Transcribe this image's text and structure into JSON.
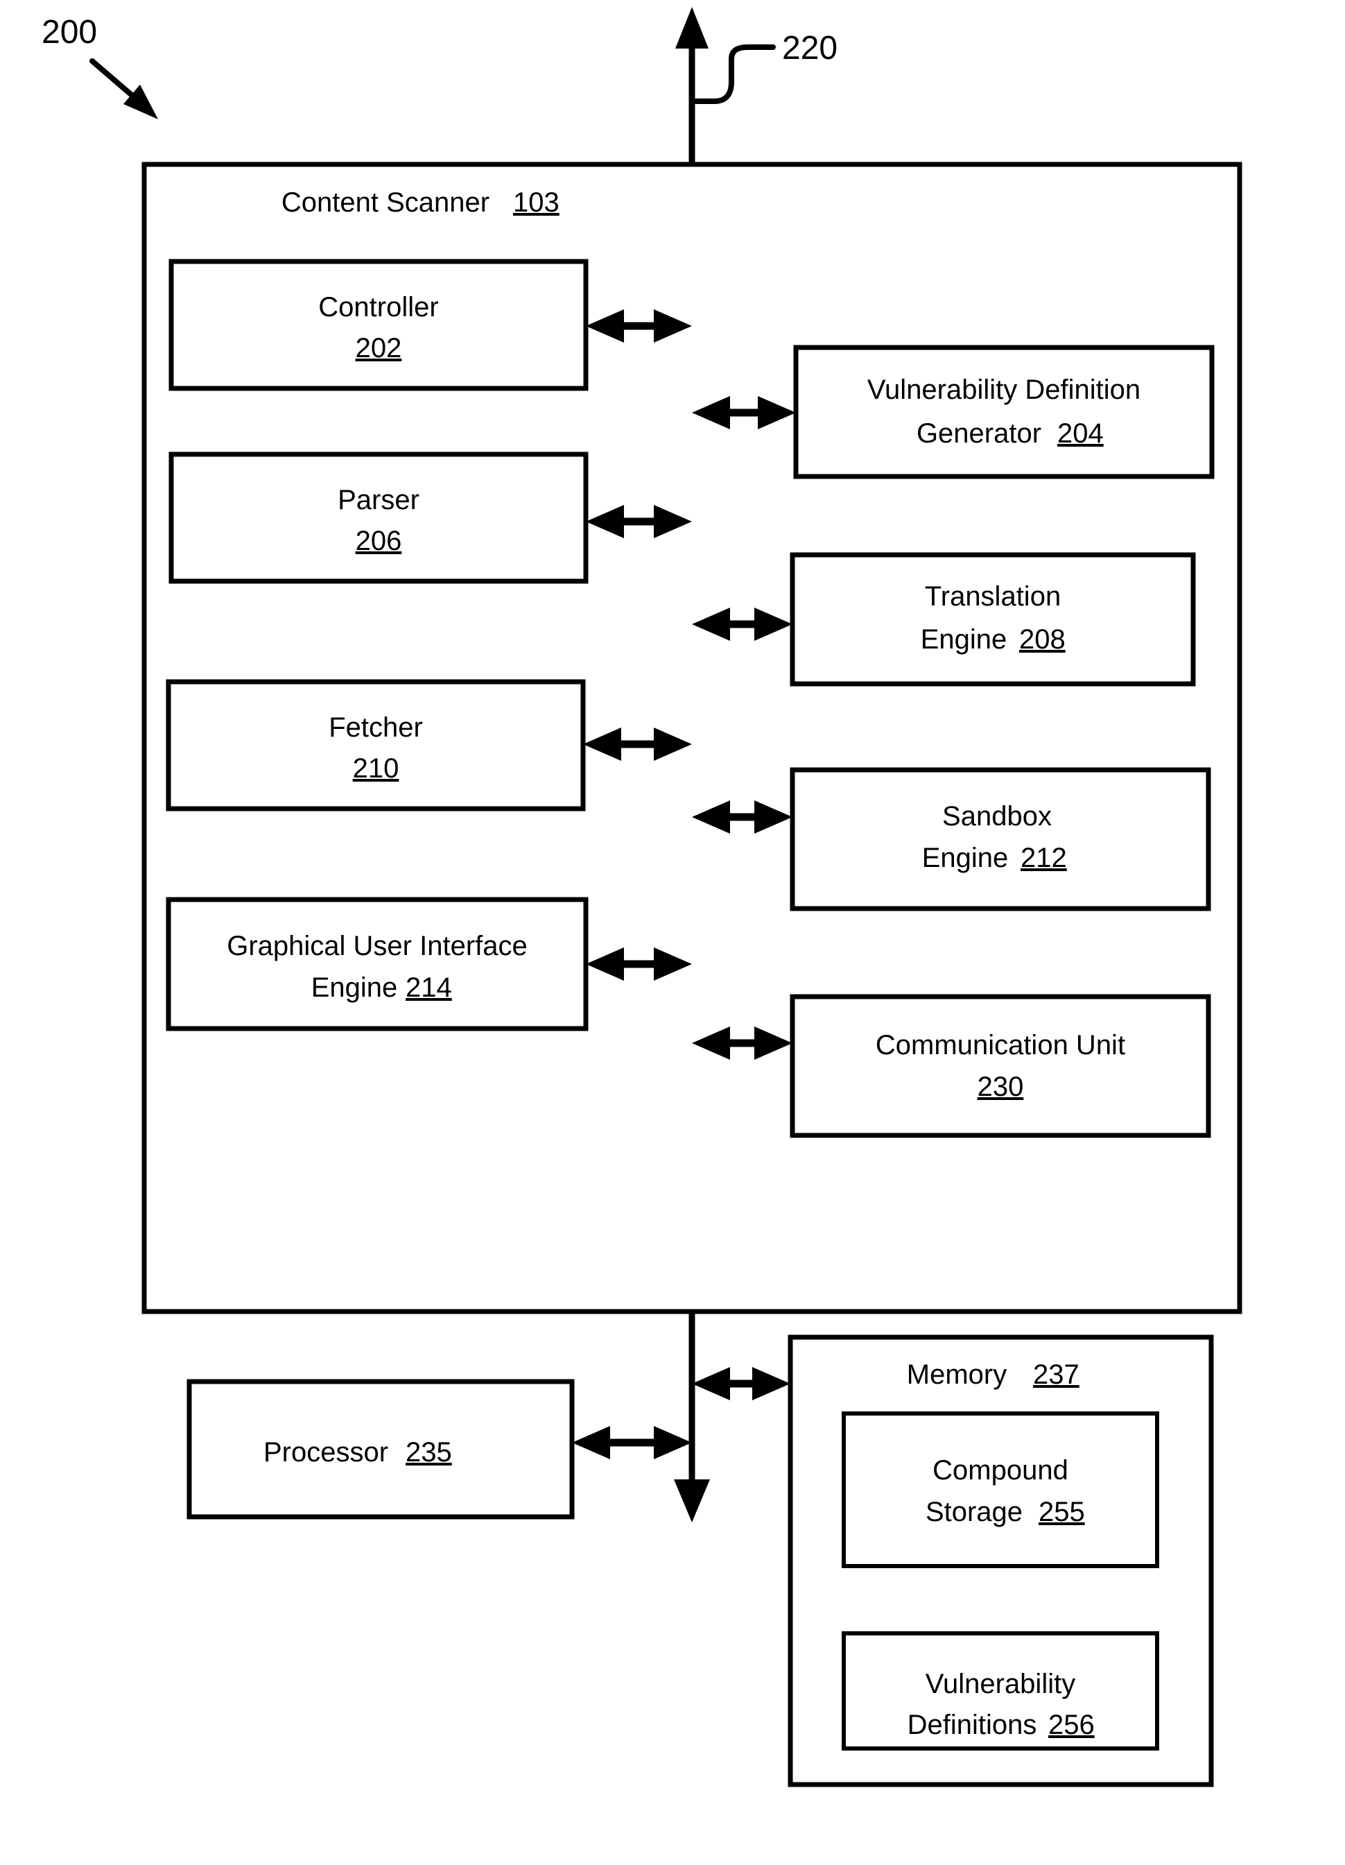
{
  "figure": {
    "figure_reference": "200",
    "bus_reference": "220"
  },
  "container": {
    "title_text": "Content Scanner",
    "title_number": "103"
  },
  "left_column": [
    {
      "line1": "Controller",
      "line2": "",
      "number": "202",
      "number_on_line2": true
    },
    {
      "line1": "Parser",
      "line2": "",
      "number": "206",
      "number_on_line2": true
    },
    {
      "line1": "Fetcher",
      "line2": "",
      "number": "210",
      "number_on_line2": true
    },
    {
      "line1": "Graphical User Interface",
      "line2": "Engine",
      "number": "214",
      "number_on_line2": false
    }
  ],
  "right_column": [
    {
      "line1": "Vulnerability Definition",
      "line2": "Generator",
      "number": "204",
      "number_on_line2": false
    },
    {
      "line1": "Translation",
      "line2": "Engine",
      "number": "208",
      "number_on_line2": false
    },
    {
      "line1": "Sandbox",
      "line2": "Engine",
      "number": "212",
      "number_on_line2": false
    },
    {
      "line1": "Communication Unit",
      "line2": "",
      "number": "230",
      "number_on_line2": true
    }
  ],
  "bottom": {
    "processor": {
      "label": "Processor",
      "number": "235"
    },
    "memory": {
      "label": "Memory",
      "number": "237",
      "children": [
        {
          "line1": "Compound",
          "line2": "Storage",
          "number": "255"
        },
        {
          "line1": "Vulnerability",
          "line2": "Definitions",
          "number": "256"
        }
      ]
    }
  }
}
